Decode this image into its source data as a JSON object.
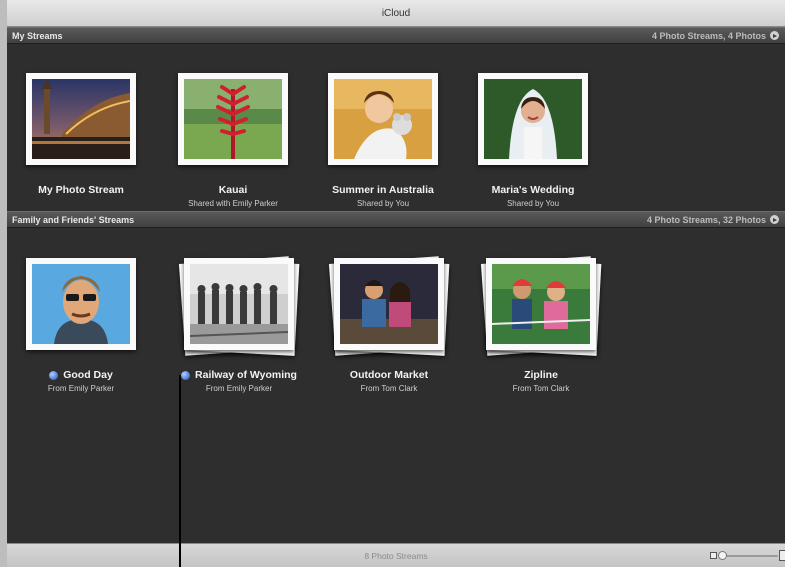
{
  "window": {
    "title": "iCloud"
  },
  "my_streams": {
    "header": "My Streams",
    "count": "4 Photo Streams, 4 Photos",
    "items": [
      {
        "title": "My Photo Stream",
        "subtitle": ""
      },
      {
        "title": "Kauai",
        "subtitle": "Shared with Emily Parker"
      },
      {
        "title": "Summer in Australia",
        "subtitle": "Shared by You"
      },
      {
        "title": "Maria's Wedding",
        "subtitle": "Shared by You"
      }
    ]
  },
  "family_streams": {
    "header": "Family and Friends' Streams",
    "count": "4 Photo Streams, 32 Photos",
    "items": [
      {
        "title": "Good Day",
        "subtitle": "From Emily Parker",
        "unread": true
      },
      {
        "title": "Railway of Wyoming",
        "subtitle": "From Emily Parker",
        "unread": true
      },
      {
        "title": "Outdoor Market",
        "subtitle": "From Tom Clark",
        "unread": false
      },
      {
        "title": "Zipline",
        "subtitle": "From Tom Clark",
        "unread": false
      }
    ]
  },
  "status": {
    "text": "8 Photo Streams"
  },
  "icons": {
    "header_arrow": "arrow-right-circle-icon",
    "unread": "blue-dot-icon",
    "zoom_small": "small-photo-icon",
    "zoom_large": "large-photo-icon"
  },
  "colors": {
    "background": "#2e2e2e",
    "unread_dot": "#4a7bd6"
  }
}
